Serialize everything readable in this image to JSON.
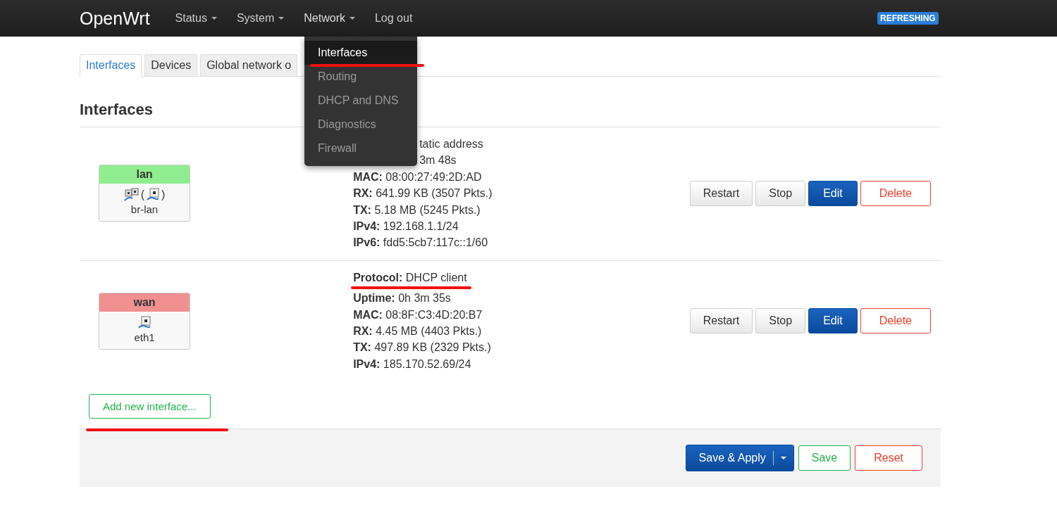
{
  "header": {
    "brand": "OpenWrt",
    "nav": [
      {
        "label": "Status",
        "has_menu": true,
        "selected": false
      },
      {
        "label": "System",
        "has_menu": true,
        "selected": false
      },
      {
        "label": "Network",
        "has_menu": true,
        "selected": true
      },
      {
        "label": "Log out",
        "has_menu": false,
        "selected": false
      }
    ],
    "indicator": "REFRESHING"
  },
  "dropdown": {
    "items": [
      {
        "label": "Interfaces",
        "selected": true,
        "underlined": true
      },
      {
        "label": "Routing",
        "selected": false,
        "underlined": false
      },
      {
        "label": "DHCP and DNS",
        "selected": false,
        "underlined": false
      },
      {
        "label": "Diagnostics",
        "selected": false,
        "underlined": false
      },
      {
        "label": "Firewall",
        "selected": false,
        "underlined": false
      }
    ]
  },
  "tabs": [
    {
      "label": "Interfaces",
      "selected": true
    },
    {
      "label": "Devices",
      "selected": false
    },
    {
      "label": "Global network o",
      "selected": false
    }
  ],
  "heading": "Interfaces",
  "interfaces": [
    {
      "name": "lan",
      "color": "#90ee90",
      "device": "br-lan",
      "icons": [
        {
          "kind": "bridge"
        },
        {
          "kind": "text",
          "text": "("
        },
        {
          "kind": "port"
        },
        {
          "kind": "text",
          "text": ")"
        }
      ],
      "lines": [
        {
          "kind": "clipped",
          "value": "tatic address",
          "underlined": false
        },
        {
          "kind": "clipped",
          "value": "3m 48s",
          "underlined": false
        },
        {
          "kind": "field",
          "label": "MAC:",
          "value": "08:00:27:49:2D:AD",
          "underlined": false
        },
        {
          "kind": "field",
          "label": "RX:",
          "value": "641.99 KB (3507 Pkts.)",
          "underlined": false
        },
        {
          "kind": "field",
          "label": "TX:",
          "value": "5.18 MB (5245 Pkts.)",
          "underlined": false
        },
        {
          "kind": "field",
          "label": "IPv4:",
          "value": "192.168.1.1/24",
          "underlined": false
        },
        {
          "kind": "field",
          "label": "IPv6:",
          "value": "fdd5:5cb7:117c::1/60",
          "underlined": false
        }
      ],
      "buttons": [
        {
          "label": "Restart",
          "kind": "neutral"
        },
        {
          "label": "Stop",
          "kind": "neutral"
        },
        {
          "label": "Edit",
          "kind": "primary"
        },
        {
          "label": "Delete",
          "kind": "negative"
        }
      ]
    },
    {
      "name": "wan",
      "color": "#f09090",
      "device": "eth1",
      "icons": [
        {
          "kind": "port"
        }
      ],
      "lines": [
        {
          "kind": "field",
          "label": "Protocol:",
          "value": "DHCP client",
          "underlined": true
        },
        {
          "kind": "field",
          "label": "Uptime:",
          "value": "0h 3m 35s",
          "underlined": false
        },
        {
          "kind": "field",
          "label": "MAC:",
          "value": "08:8F:C3:4D:20:B7",
          "underlined": false
        },
        {
          "kind": "field",
          "label": "RX:",
          "value": "4.45 MB (4403 Pkts.)",
          "underlined": false
        },
        {
          "kind": "field",
          "label": "TX:",
          "value": "497.89 KB (2329 Pkts.)",
          "underlined": false
        },
        {
          "kind": "field",
          "label": "IPv4:",
          "value": "185.170.52.69/24",
          "underlined": false
        }
      ],
      "buttons": [
        {
          "label": "Restart",
          "kind": "neutral"
        },
        {
          "label": "Stop",
          "kind": "neutral"
        },
        {
          "label": "Edit",
          "kind": "primary"
        },
        {
          "label": "Delete",
          "kind": "negative"
        }
      ]
    }
  ],
  "add_button": {
    "label": "Add new interface...",
    "underlined": true
  },
  "footer": {
    "buttons": [
      {
        "label": "Save & Apply",
        "kind": "primary-split"
      },
      {
        "label": "Save",
        "kind": "positive"
      },
      {
        "label": "Reset",
        "kind": "negative"
      }
    ]
  }
}
